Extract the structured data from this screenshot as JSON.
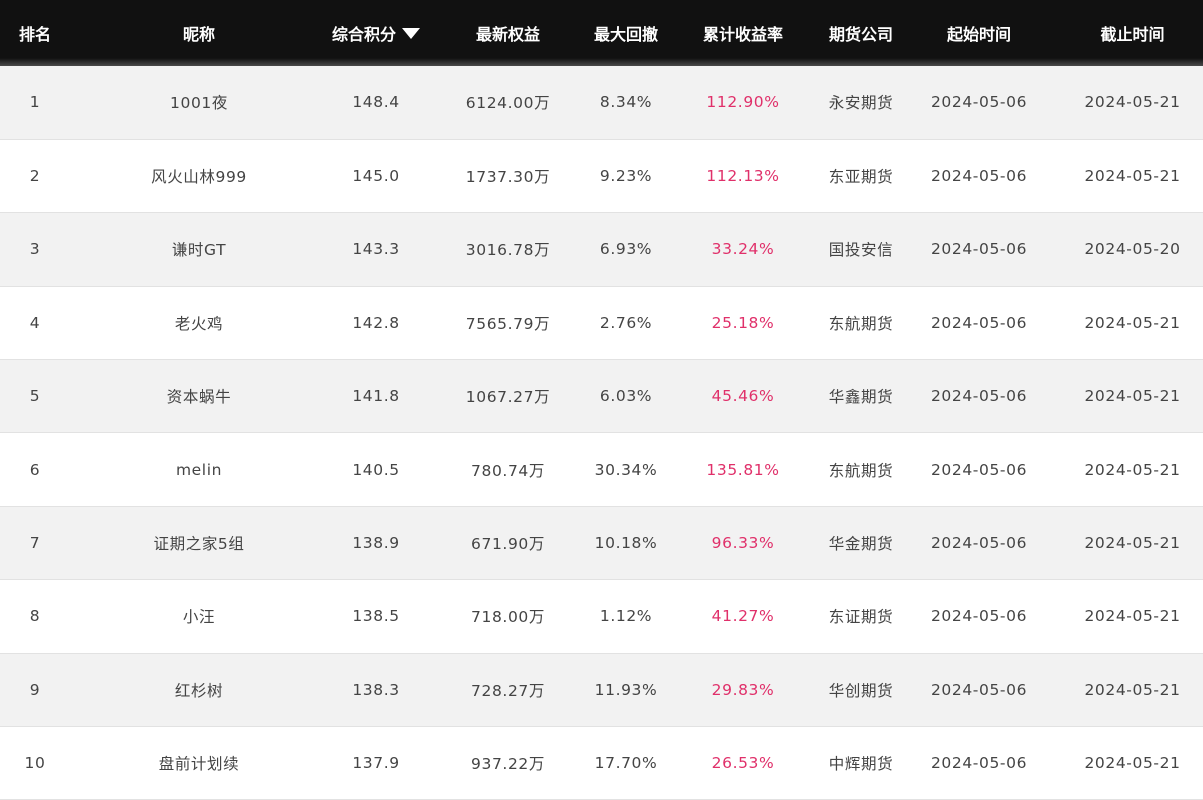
{
  "table": {
    "headers": {
      "rank": "排名",
      "nickname": "昵称",
      "score": "综合积分",
      "equity": "最新权益",
      "drawdown": "最大回撤",
      "return": "累计收益率",
      "broker": "期货公司",
      "start": "起始时间",
      "end": "截止时间"
    },
    "sort_indicator": "descending",
    "rows": [
      {
        "rank": "1",
        "nickname": "1001夜",
        "score": "148.4",
        "equity": "6124.00万",
        "drawdown": "8.34%",
        "return": "112.90%",
        "broker": "永安期货",
        "start": "2024-05-06",
        "end": "2024-05-21"
      },
      {
        "rank": "2",
        "nickname": "风火山林999",
        "score": "145.0",
        "equity": "1737.30万",
        "drawdown": "9.23%",
        "return": "112.13%",
        "broker": "东亚期货",
        "start": "2024-05-06",
        "end": "2024-05-21"
      },
      {
        "rank": "3",
        "nickname": "谦时GT",
        "score": "143.3",
        "equity": "3016.78万",
        "drawdown": "6.93%",
        "return": "33.24%",
        "broker": "国投安信",
        "start": "2024-05-06",
        "end": "2024-05-20"
      },
      {
        "rank": "4",
        "nickname": "老火鸡",
        "score": "142.8",
        "equity": "7565.79万",
        "drawdown": "2.76%",
        "return": "25.18%",
        "broker": "东航期货",
        "start": "2024-05-06",
        "end": "2024-05-21"
      },
      {
        "rank": "5",
        "nickname": "资本蜗牛",
        "score": "141.8",
        "equity": "1067.27万",
        "drawdown": "6.03%",
        "return": "45.46%",
        "broker": "华鑫期货",
        "start": "2024-05-06",
        "end": "2024-05-21"
      },
      {
        "rank": "6",
        "nickname": "melin",
        "score": "140.5",
        "equity": "780.74万",
        "drawdown": "30.34%",
        "return": "135.81%",
        "broker": "东航期货",
        "start": "2024-05-06",
        "end": "2024-05-21"
      },
      {
        "rank": "7",
        "nickname": "证期之家5组",
        "score": "138.9",
        "equity": "671.90万",
        "drawdown": "10.18%",
        "return": "96.33%",
        "broker": "华金期货",
        "start": "2024-05-06",
        "end": "2024-05-21"
      },
      {
        "rank": "8",
        "nickname": "小汪",
        "score": "138.5",
        "equity": "718.00万",
        "drawdown": "1.12%",
        "return": "41.27%",
        "broker": "东证期货",
        "start": "2024-05-06",
        "end": "2024-05-21"
      },
      {
        "rank": "9",
        "nickname": "红杉树",
        "score": "138.3",
        "equity": "728.27万",
        "drawdown": "11.93%",
        "return": "29.83%",
        "broker": "华创期货",
        "start": "2024-05-06",
        "end": "2024-05-21"
      },
      {
        "rank": "10",
        "nickname": "盘前计划续",
        "score": "137.9",
        "equity": "937.22万",
        "drawdown": "17.70%",
        "return": "26.53%",
        "broker": "中辉期货",
        "start": "2024-05-06",
        "end": "2024-05-21"
      }
    ]
  },
  "colors": {
    "header_bg": "#111111",
    "header_text": "#ffffff",
    "row_alt_bg": "#f2f2f2",
    "row_bg": "#ffffff",
    "body_text": "#444444",
    "return_text": "#e0306a"
  }
}
